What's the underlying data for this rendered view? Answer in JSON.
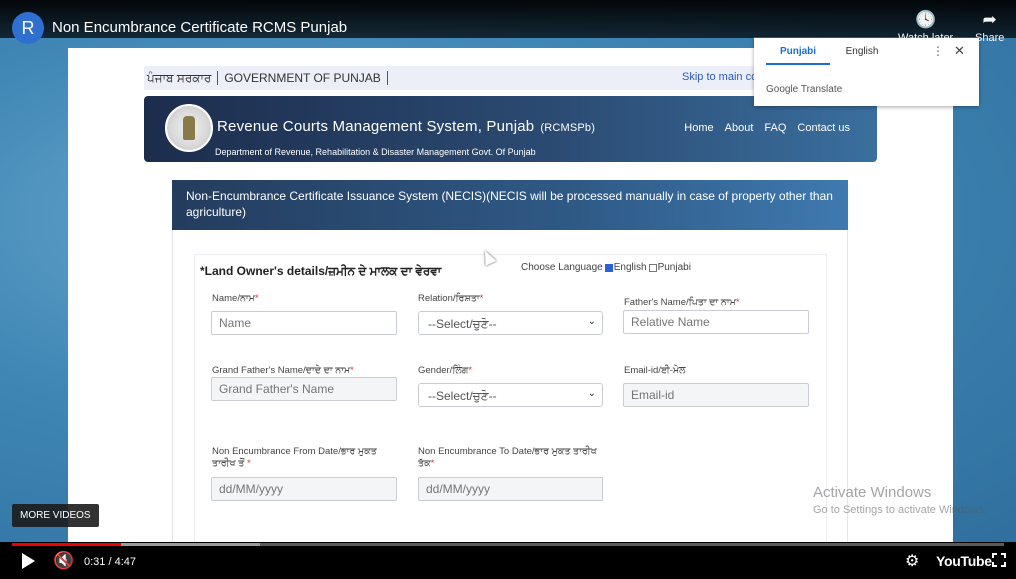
{
  "video": {
    "channel_initial": "R",
    "title": "Non Encumbrance Certificate RCMS Punjab",
    "watch_later_label": "Watch later",
    "share_label": "Share",
    "more_videos_label": "MORE VIDEOS",
    "time": "0:31 / 4:47",
    "progress_fraction": 0.11,
    "buffered_fraction": 0.25,
    "brand": "YouTube"
  },
  "site": {
    "topstrip_left": "ਪੰਜਾਬ ਸਰਕਾਰ",
    "topstrip_right": "GOVERNMENT OF PUNJAB",
    "skip_link": "Skip to main co",
    "title": "Revenue Courts Management System, Punjab",
    "abbr": "(RCMSPb)",
    "department": "Department of Revenue, Rehabilitation & Disaster Management Govt. Of Punjab",
    "nav": [
      "Home",
      "About",
      "FAQ",
      "Contact us"
    ]
  },
  "form": {
    "header": "Non-Encumbrance Certificate Issuance System (NECIS)(NECIS will be processed manually in case of property other than agriculture)",
    "section_title": "*Land Owner's details/ਜ਼ਮੀਨ ਦੇ ਮਾਲਕ ਦਾ ਵੇਰਵਾ",
    "choose_language_label": "Choose Language",
    "lang_english": "English",
    "lang_punjabi": "Punjabi",
    "fields": {
      "name": {
        "label": "Name/ਨਾਮ",
        "required": "*",
        "placeholder": "Name"
      },
      "relation": {
        "label": "Relation/ਰਿਸ਼ਤਾ",
        "required": "*",
        "selected": "--Select/ਚੁਣੋ--"
      },
      "father": {
        "label": "Father's Name/ਪਿਤਾ ਦਾ ਨਾਮ",
        "required": "*",
        "placeholder": "Relative Name"
      },
      "grandfather": {
        "label": "Grand Father's Name/ਦਾਦੇ ਦਾ ਨਾਮ",
        "required": "*",
        "placeholder": "Grand Father's Name"
      },
      "gender": {
        "label": "Gender/ਲਿੰਗ",
        "required": "*",
        "selected": "--Select/ਚੁਣੋ--"
      },
      "email": {
        "label": "Email-id/ਈ-ਮੇਲ",
        "required": "",
        "placeholder": "Email-id"
      },
      "from_date": {
        "label": "Non Encumbrance From Date/ਭਾਰ ਮੁਕਤ ਤਾਰੀਖ ਤੋਂ",
        "required": "*",
        "placeholder": "dd/MM/yyyy"
      },
      "to_date": {
        "label": "Non Encumbrance To Date/ਭਾਰ ਮੁਕਤ ਤਾਰੀਖ ਤੱਕ",
        "required": "*",
        "placeholder": "dd/MM/yyyy"
      }
    }
  },
  "translate_popup": {
    "tab_active": "Punjabi",
    "tab_other": "English",
    "brand": "Google Translate"
  },
  "watermark": {
    "line1": "Activate Windows",
    "line2": "Go to Settings to activate Windows."
  }
}
